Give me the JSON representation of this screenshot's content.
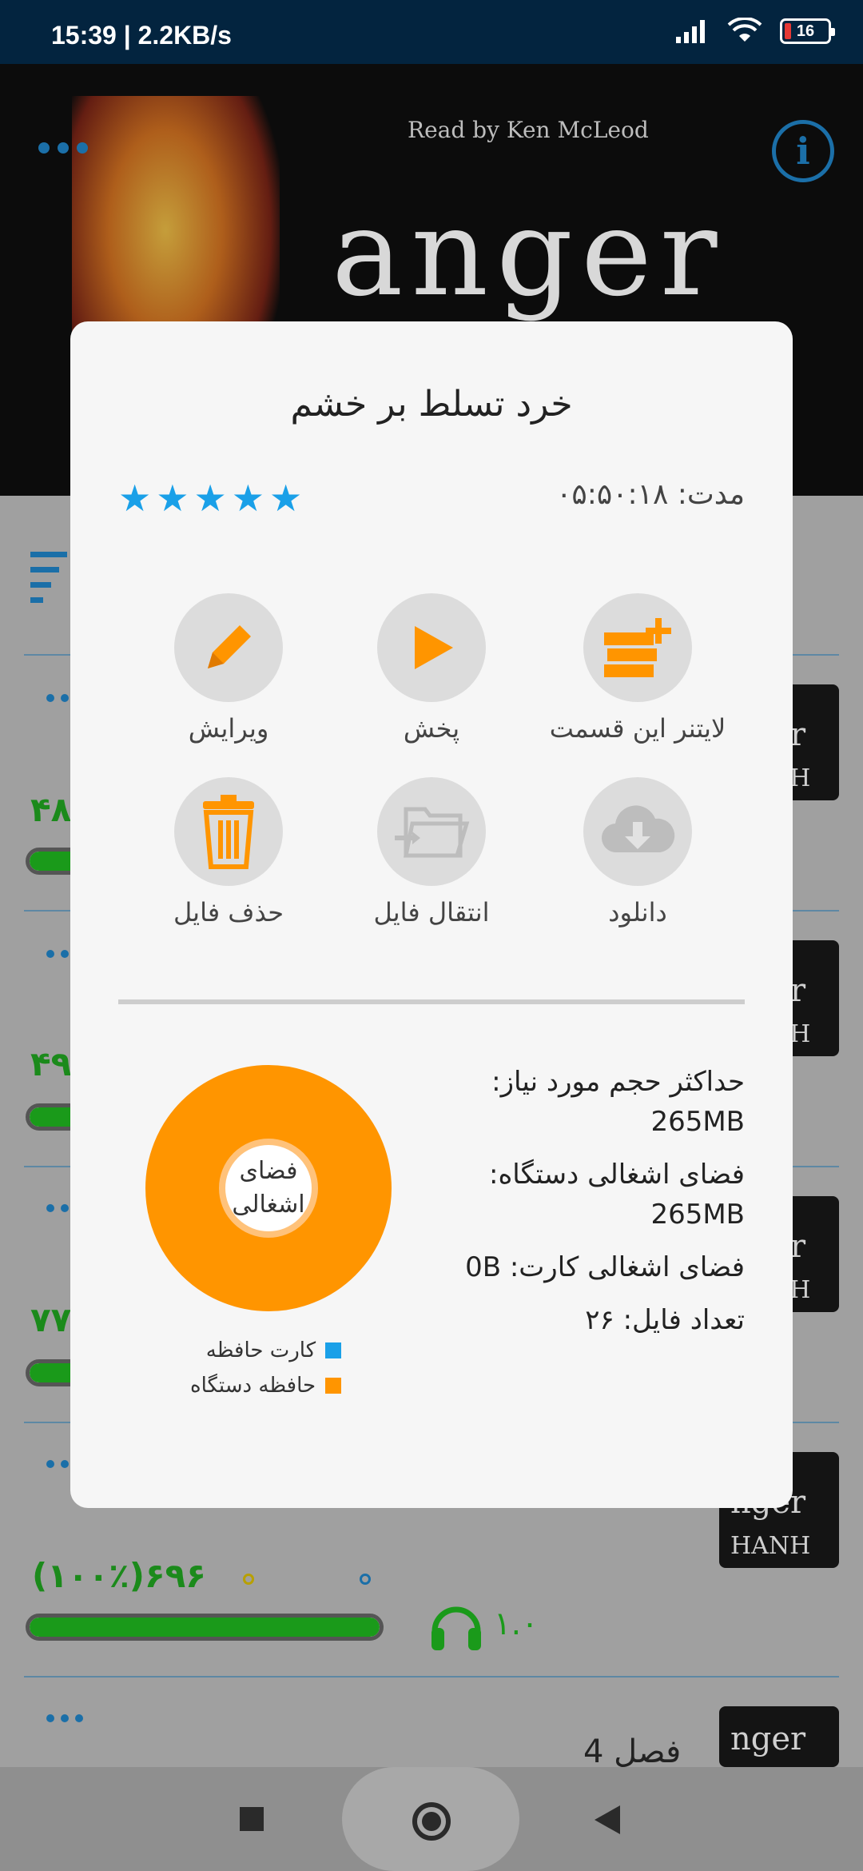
{
  "status_bar": {
    "time_speed": "15:39 | 2.2KB/s",
    "battery": "16"
  },
  "header": {
    "read_by": "Read by Ken McLeod",
    "cover_title": "anger"
  },
  "list": {
    "rows": [
      {
        "count": "۴۸"
      },
      {
        "count": "۴۹"
      },
      {
        "count": "۷۷"
      },
      {
        "count": "۶۹۶(۱۰۰٪)",
        "speed": "۱.۰"
      }
    ],
    "thumb_text": "nger",
    "thumb_author": "HANH",
    "chapter_title": "فصل 4"
  },
  "dialog": {
    "title": "خرد تسلط بر خشم",
    "rating_stars": 5,
    "duration": "مدت: ۰۵:۵۰:۱۸",
    "actions": {
      "edit": "ویرایش",
      "play": "پخش",
      "leitner": "لایتنر این قسمت",
      "delete": "حذف فایل",
      "move": "انتقال فایل",
      "download": "دانلود"
    },
    "chart_data": {
      "type": "pie",
      "center_label": "فضای اشغالی",
      "categories": [
        "کارت حافظه",
        "حافظه دستگاه"
      ],
      "values": [
        0,
        265
      ],
      "colors": [
        "#1aa0e8",
        "#ff9500"
      ]
    },
    "info": {
      "max_size_label": "حداکثر حجم مورد نیاز:",
      "max_size_value": "265MB",
      "device_used_label": "فضای اشغالی دستگاه:",
      "device_used_value": "265MB",
      "card_used": "فضای اشغالی کارت: 0B",
      "file_count": "تعداد فایل: ۲۶"
    }
  },
  "colors": {
    "accent_blue": "#1aa0e8",
    "accent_orange": "#ff9500",
    "progress_green": "#1a9a1a"
  }
}
